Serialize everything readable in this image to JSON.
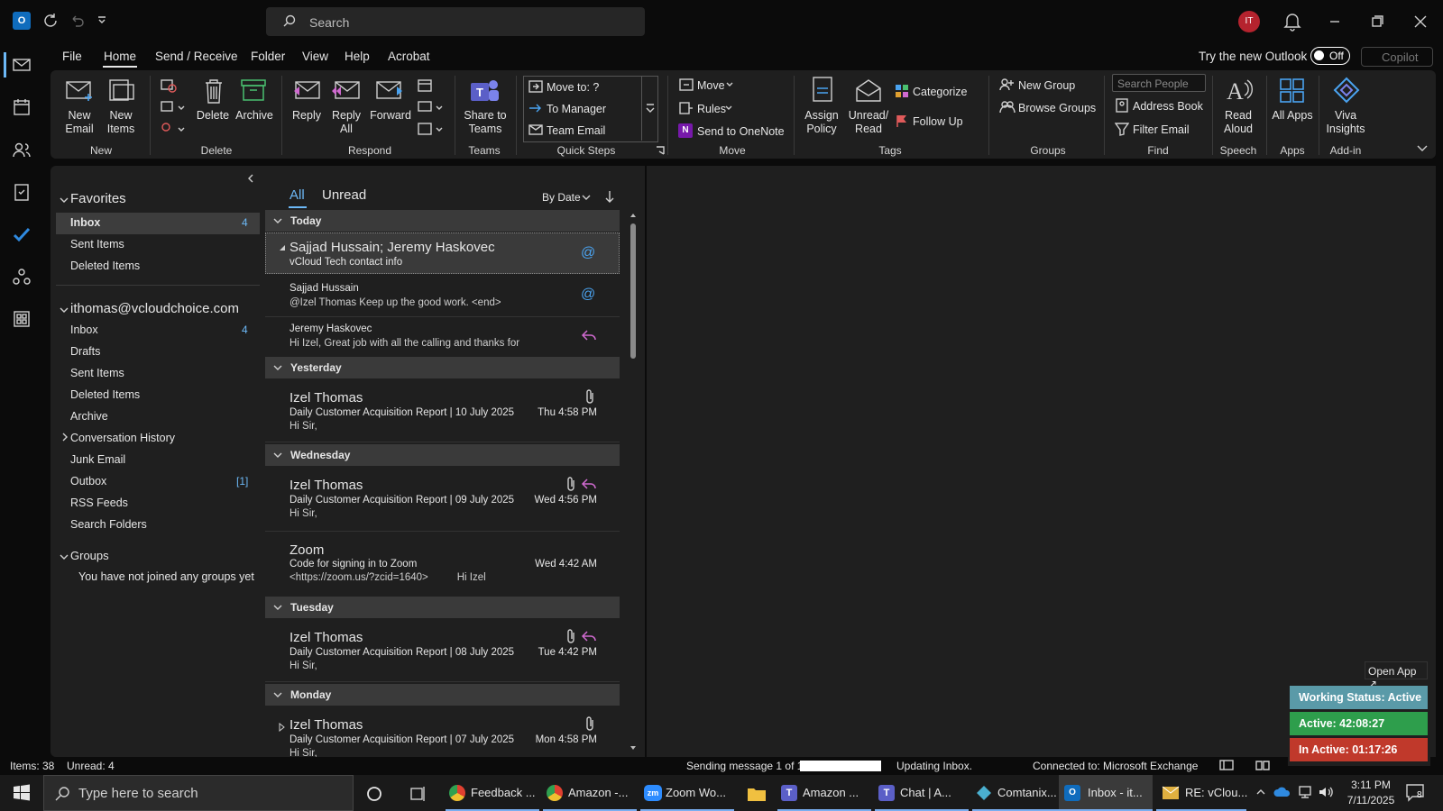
{
  "titlebar": {
    "search_placeholder": "Search",
    "avatar_initials": "IT"
  },
  "menu": {
    "tabs": [
      "File",
      "Home",
      "Send / Receive",
      "Folder",
      "View",
      "Help",
      "Acrobat"
    ],
    "try_new": "Try the new Outlook",
    "toggle": "Off",
    "copilot": "Copilot"
  },
  "ribbon": {
    "groups": {
      "new": "New",
      "delete": "Delete",
      "respond": "Respond",
      "teams": "Teams",
      "quick_steps": "Quick Steps",
      "move": "Move",
      "tags": "Tags",
      "groups": "Groups",
      "find": "Find",
      "speech": "Speech",
      "apps": "Apps",
      "addin": "Add-in"
    },
    "new_email": "New Email",
    "new_items": "New Items",
    "delete": "Delete",
    "archive": "Archive",
    "reply": "Reply",
    "reply_all": "Reply All",
    "forward": "Forward",
    "share_teams": "Share to Teams",
    "qs_move_to": "Move to: ?",
    "qs_to_manager": "To Manager",
    "qs_team_email": "Team Email",
    "move": "Move",
    "rules": "Rules",
    "send_onenote": "Send to OneNote",
    "assign_policy": "Assign Policy",
    "unread_read": "Unread/ Read",
    "categorize": "Categorize",
    "follow_up": "Follow Up",
    "new_group": "New Group",
    "browse_groups": "Browse Groups",
    "search_people": "Search People",
    "address_book": "Address Book",
    "filter_email": "Filter Email",
    "read_aloud": "Read Aloud",
    "all_apps": "All Apps",
    "viva_insights": "Viva Insights"
  },
  "folders": {
    "favorites": "Favorites",
    "fav_items": [
      {
        "label": "Inbox",
        "count": "4"
      },
      {
        "label": "Sent Items",
        "count": ""
      },
      {
        "label": "Deleted Items",
        "count": ""
      }
    ],
    "account": "ithomas@vcloudchoice.com",
    "acct_items": [
      {
        "label": "Inbox",
        "count": "4"
      },
      {
        "label": "Drafts",
        "count": ""
      },
      {
        "label": "Sent Items",
        "count": ""
      },
      {
        "label": "Deleted Items",
        "count": ""
      },
      {
        "label": "Archive",
        "count": ""
      },
      {
        "label": "Conversation History",
        "count": ""
      },
      {
        "label": "Junk Email",
        "count": ""
      },
      {
        "label": "Outbox",
        "count": "[1]"
      },
      {
        "label": "RSS Feeds",
        "count": ""
      },
      {
        "label": "Search Folders",
        "count": ""
      }
    ],
    "groups": "Groups",
    "groups_note": "You have not joined any groups yet"
  },
  "list": {
    "tab_all": "All",
    "tab_unread": "Unread",
    "sort": "By Date",
    "groups": [
      "Today",
      "Yesterday",
      "Wednesday",
      "Tuesday",
      "Monday"
    ],
    "msgs": [
      {
        "sender": "Sajjad Hussain;  Jeremy Haskovec",
        "subject": "vCloud Tech contact info",
        "preview": "",
        "date": ""
      },
      {
        "sender": "Sajjad Hussain",
        "subject": "@Izel Thomas Keep up the good work. <end>",
        "preview": "",
        "date": ""
      },
      {
        "sender": "Jeremy Haskovec",
        "subject": "Hi Izel,  Great job with all the calling and thanks for",
        "preview": "",
        "date": ""
      },
      {
        "sender": "Izel Thomas",
        "subject": "Daily Customer Acquisition Report | 10 July 2025",
        "preview": "Hi Sir,",
        "date": "Thu 4:58 PM"
      },
      {
        "sender": "Izel Thomas",
        "subject": "Daily Customer Acquisition Report | 09 July 2025",
        "preview": "Hi Sir,",
        "date": "Wed 4:56 PM"
      },
      {
        "sender": "Zoom",
        "subject": "Code for signing in to Zoom",
        "preview": "<https://zoom.us/?zcid=1640>          Hi Izel",
        "date": "Wed 4:42 AM"
      },
      {
        "sender": "Izel Thomas",
        "subject": "Daily Customer Acquisition Report | 08 July 2025",
        "preview": "Hi Sir,",
        "date": "Tue 4:42 PM"
      },
      {
        "sender": "Izel Thomas",
        "subject": "Daily Customer Acquisition Report | 07 July 2025",
        "preview": "Hi Sir,",
        "date": "Mon 4:58 PM"
      }
    ]
  },
  "status": {
    "items": "Items: 38",
    "unread": "Unread: 4",
    "sending": "Sending message 1 of 1",
    "updating": "Updating Inbox.",
    "connected": "Connected to: Microsoft Exchange"
  },
  "widget": {
    "open_app": "Open App ↗",
    "working": "Working Status: Active",
    "active": "Active: 42:08:27",
    "inactive": "In Active: 01:17:26",
    "colors": {
      "working": "#5a9aa8",
      "active": "#2e9e4c",
      "inactive": "#c0392b"
    }
  },
  "taskbar": {
    "search_placeholder": "Type here to search",
    "apps": [
      {
        "label": "Feedback ..."
      },
      {
        "label": "Amazon -..."
      },
      {
        "label": "Zoom Wo..."
      },
      {
        "label": ""
      },
      {
        "label": "Amazon ..."
      },
      {
        "label": "Chat | A..."
      },
      {
        "label": "Comtanix..."
      },
      {
        "label": "Inbox - it..."
      },
      {
        "label": "RE: vClou..."
      }
    ],
    "time": "3:11 PM",
    "date": "7/11/2025",
    "notif_count": "8"
  }
}
